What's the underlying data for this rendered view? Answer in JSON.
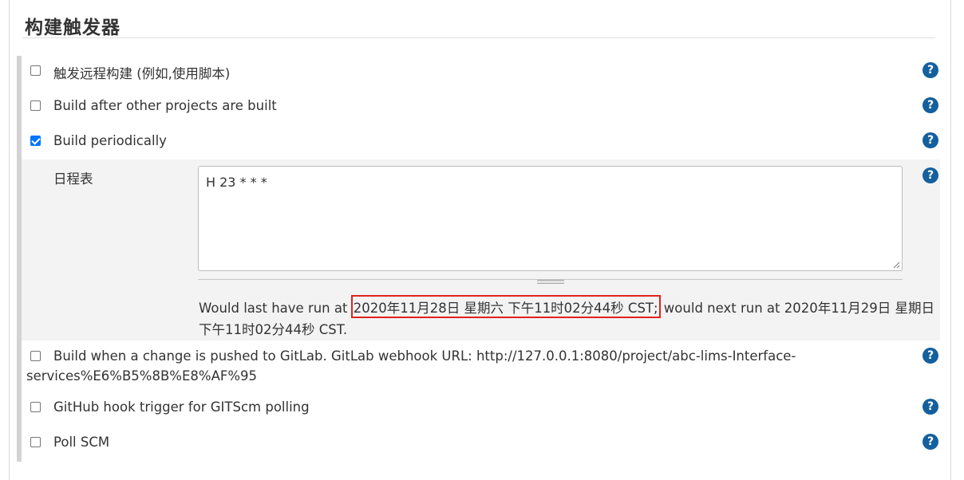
{
  "section": {
    "title": "构建触发器"
  },
  "triggers": [
    {
      "label": "触发远程构建 (例如,使用脚本)",
      "checked": false
    },
    {
      "label": "Build after other projects are built",
      "checked": false
    },
    {
      "label": "Build periodically",
      "checked": true
    },
    {
      "label": "Build when a change is pushed to GitLab. GitLab webhook URL: http://127.0.0.1:8080/project/abc-lims-Interface-",
      "label_cont": "services%E6%B5%8B%E8%AF%95",
      "checked": false
    },
    {
      "label": "GitHub hook trigger for GITScm polling",
      "checked": false
    },
    {
      "label": "Poll SCM",
      "checked": false
    }
  ],
  "schedule": {
    "label": "日程表",
    "value": "H 23 * * *",
    "status_prefix": "Would last have run at ",
    "last_run": "2020年11月28日 星期六 下午11时02分44秒 CST;",
    "status_mid": " would next run at 2020年11月29日 星期日",
    "status_line2": "下午11时02分44秒 CST."
  },
  "help_glyph": "?",
  "icons": {
    "help": "help-icon",
    "checkbox": "checkbox-icon",
    "resize": "resize-grip-icon"
  },
  "colors": {
    "help": "#14609e",
    "checked": "#0075ff",
    "highlight": "#e0231e",
    "panel": "#f3f3f3"
  }
}
